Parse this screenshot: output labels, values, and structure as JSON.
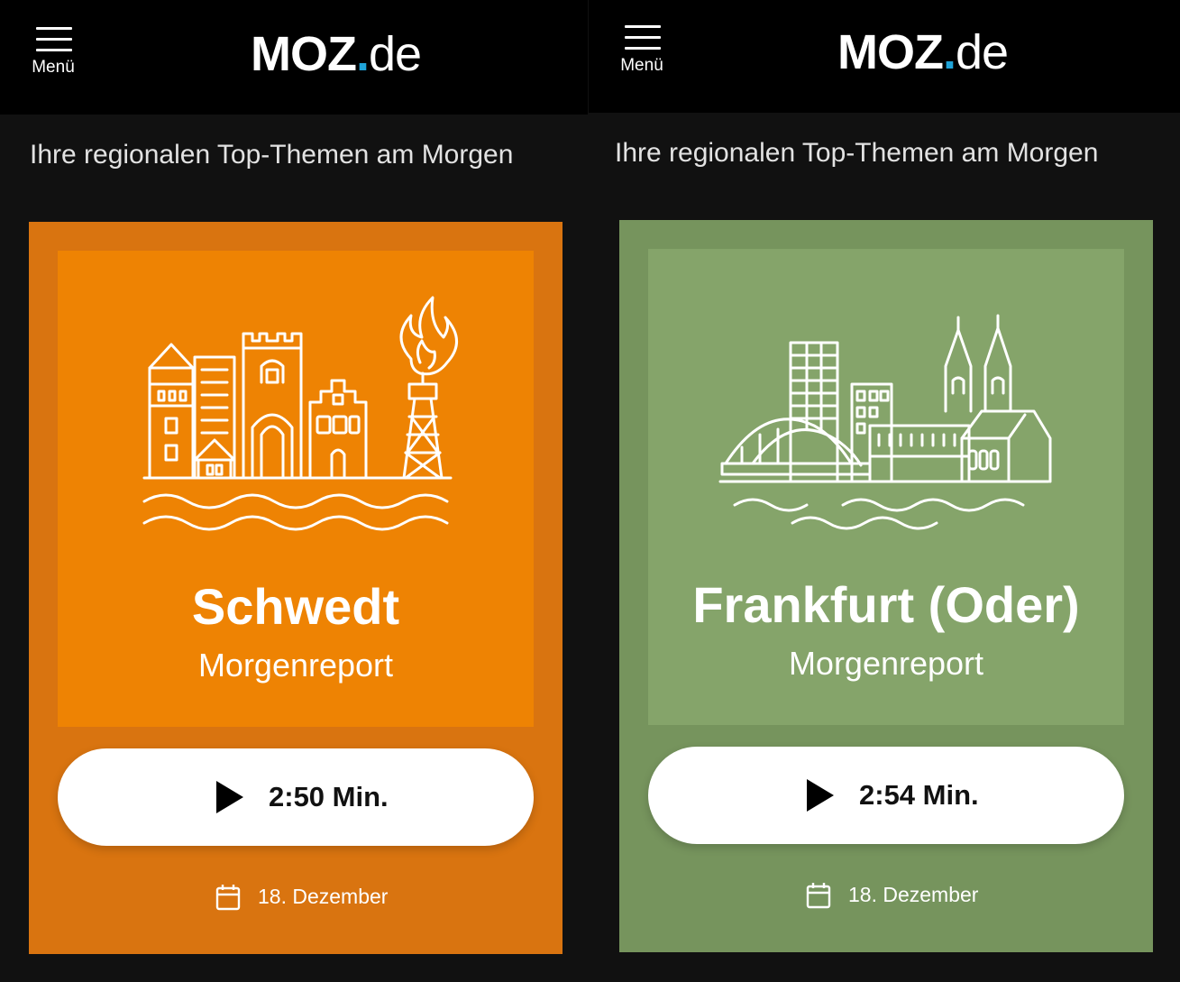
{
  "colors": {
    "background": "#111111",
    "header": "#000000",
    "logo_dot": "#1fa3d8",
    "schwedt_card": "#d97410",
    "schwedt_inner": "#ee8303",
    "frankfurt_card": "#76945d",
    "frankfurt_inner": "#85a46a"
  },
  "screens": [
    {
      "header": {
        "menu_label": "Menü",
        "logo_main": "MOZ",
        "logo_dot": ".",
        "logo_tld": "de",
        "menu_icon": "hamburger-icon"
      },
      "intro": "Ihre regionalen Top-Themen am Morgen",
      "card": {
        "city": "Schwedt",
        "subtitle": "Morgenreport",
        "duration": "2:50 Min.",
        "date": "18. Dezember",
        "illustration": "schwedt-skyline-icon",
        "play_icon": "play-icon",
        "date_icon": "calendar-icon"
      }
    },
    {
      "header": {
        "menu_label": "Menü",
        "logo_main": "MOZ",
        "logo_dot": ".",
        "logo_tld": "de",
        "menu_icon": "hamburger-icon"
      },
      "intro": "Ihre regionalen Top-Themen am Morgen",
      "card": {
        "city": "Frankfurt (Oder)",
        "subtitle": "Morgenreport",
        "duration": "2:54 Min.",
        "date": "18. Dezember",
        "illustration": "frankfurt-skyline-icon",
        "play_icon": "play-icon",
        "date_icon": "calendar-icon"
      }
    }
  ]
}
